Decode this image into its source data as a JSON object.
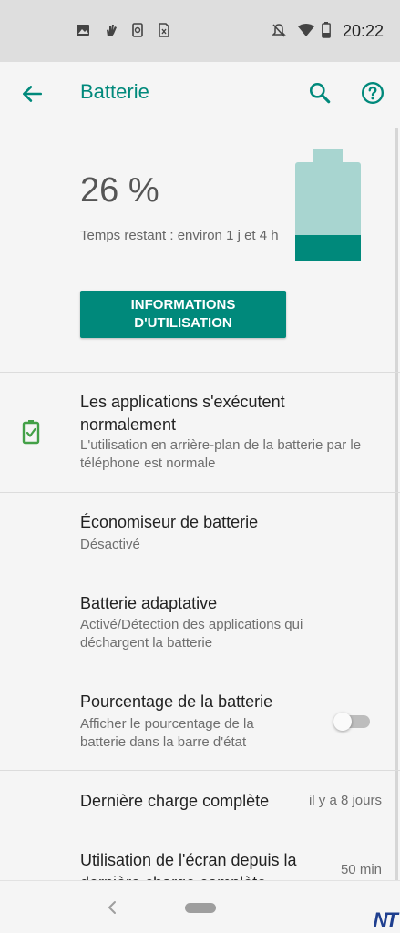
{
  "status_bar": {
    "time": "20:22",
    "left_icons": [
      "image-icon",
      "hand-icon",
      "phone-sync-icon",
      "sim-icon"
    ],
    "right_icons": [
      "notifications-off-icon",
      "wifi-icon",
      "battery-icon"
    ]
  },
  "app_bar": {
    "title": "Batterie",
    "accent_color": "#00897b"
  },
  "battery": {
    "percent_text": "26 %",
    "level": 0.26,
    "remaining": "Temps restant : environ 1 j et 4 h",
    "usage_button": "INFORMATIONS D'UTILISATION",
    "fill_color": "#00897b",
    "empty_color": "#a8d5d0"
  },
  "apps_status": {
    "title": "Les applications s'exécutent normalement",
    "subtitle": "L'utilisation en arrière-plan de la batterie par le téléphone est normale",
    "icon": "battery-check-icon",
    "icon_color": "#43a047"
  },
  "battery_saver": {
    "title": "Économiseur de batterie",
    "subtitle": "Désactivé"
  },
  "adaptive_battery": {
    "title": "Batterie adaptative",
    "subtitle": "Activé/Détection des applications qui déchargent la batterie"
  },
  "battery_percentage": {
    "title": "Pourcentage de la batterie",
    "subtitle": "Afficher le pourcentage de la batterie dans la barre d'état",
    "enabled": false
  },
  "last_full_charge": {
    "title": "Dernière charge complète",
    "value": "il y a 8 jours"
  },
  "screen_usage": {
    "title": "Utilisation de l'écran depuis la dernière charge complète",
    "value": "50 min"
  },
  "watermark": "NT"
}
